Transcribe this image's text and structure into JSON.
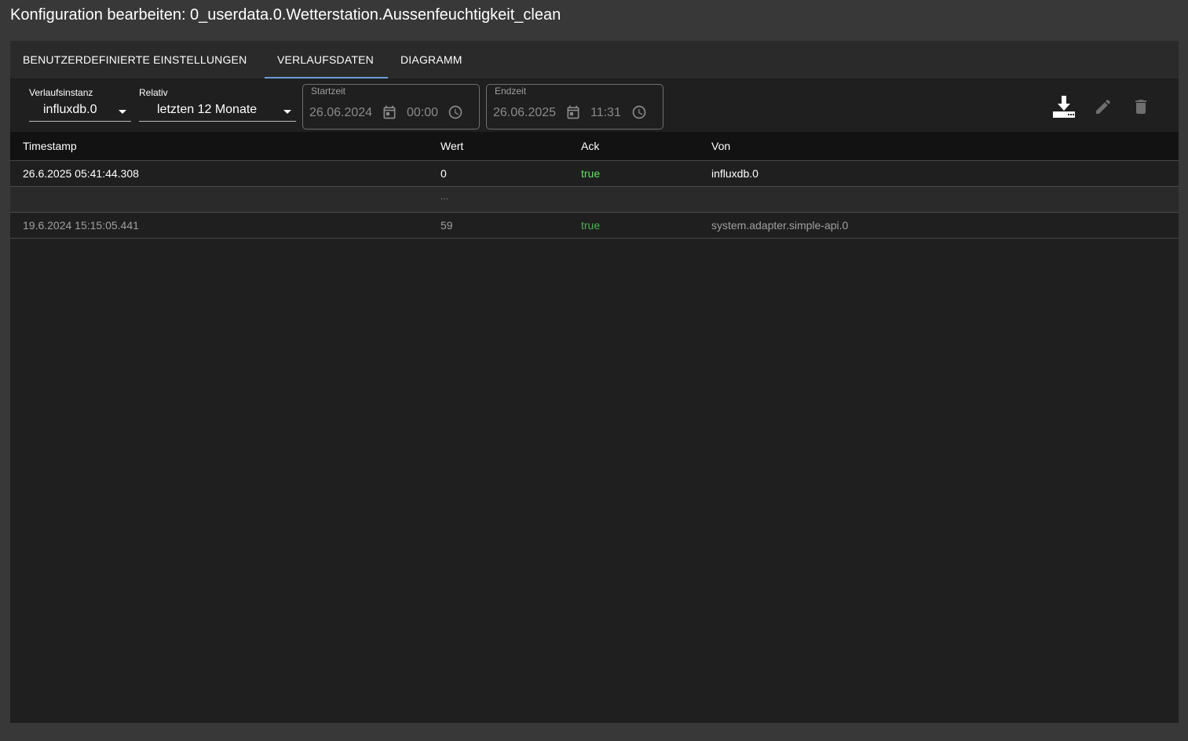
{
  "window": {
    "title": "Konfiguration bearbeiten: 0_userdata.0.Wetterstation.Aussenfeuchtigkeit_clean"
  },
  "tabs": [
    {
      "label": "BENUTZERDEFINIERTE EINSTELLUNGEN",
      "active": false
    },
    {
      "label": "VERLAUFSDATEN",
      "active": true
    },
    {
      "label": "DIAGRAMM",
      "active": false
    }
  ],
  "filters": {
    "instance": {
      "label": "Verlaufsinstanz",
      "value": "influxdb.0"
    },
    "relative": {
      "label": "Relativ",
      "value": "letzten 12 Monate"
    },
    "start": {
      "label": "Startzeit",
      "date": "26.06.2024",
      "time": "00:00"
    },
    "end": {
      "label": "Endzeit",
      "date": "26.06.2025",
      "time": "11:31"
    }
  },
  "actions": {
    "download_icon": "download-icon",
    "edit_icon": "pencil-icon",
    "delete_icon": "trash-icon"
  },
  "table": {
    "columns": [
      "Timestamp",
      "Wert",
      "Ack",
      "Von"
    ],
    "rows": [
      {
        "timestamp": "26.6.2025 05:41:44.308",
        "value": "0",
        "ack": "true",
        "from": "influxdb.0"
      },
      {
        "gap": "..."
      },
      {
        "timestamp": "19.6.2024 15:15:05.441",
        "value": "59",
        "ack": "true",
        "from": "system.adapter.simple-api.0"
      }
    ]
  },
  "colors": {
    "accent": "#6a9ed6",
    "ack_true": "#66e066",
    "background": "#1f1f1f"
  }
}
